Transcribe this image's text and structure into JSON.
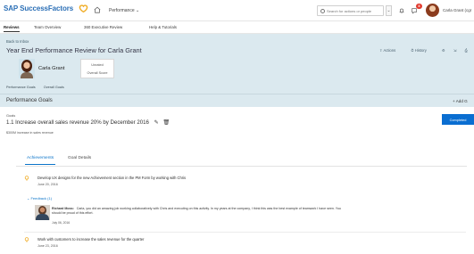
{
  "app": {
    "brand": "SAP SuccessFactors",
    "module": "Performance",
    "search_placeholder": "Search for actions or people",
    "notification_count": "8",
    "user_name": "Carla Grant (cgr"
  },
  "nav": {
    "tabs": [
      "Reviews",
      "Team Overview",
      "360 Executive Review",
      "Help & Tutorials"
    ]
  },
  "review": {
    "back_label": "Back to Inbox",
    "title": "Year End Performance Review for Carla Grant",
    "actions": [
      "Actions",
      "History"
    ],
    "person_name": "Carla Grant",
    "score_value": "Unrated",
    "score_label": "Overall Score",
    "sections": [
      "Performance Goals",
      "Overall Goals"
    ]
  },
  "performance_goals": {
    "heading": "Performance Goals",
    "add_goal_label": "+ Add G",
    "goals_label": "Goals",
    "goal_title": "1.1 Increase overall sales revenue 20% by December 2016",
    "goal_meta": "$300M increase in sales revenue",
    "complete_label": "Completed",
    "tabs": [
      "Achievements",
      "Goal Details"
    ],
    "achievements": [
      {
        "title": "Develop UX designs for the new Achievement section in the PM Form by working with Chris",
        "date": "June 20, 2016"
      },
      {
        "title": "Work with customers to increase the sales revenue for the quarter",
        "date": "June 23, 2016"
      }
    ],
    "feedback": {
      "link": "Feedback (1)",
      "name": "Richard Moss:",
      "text": "Carla, you did an amazing job working collaboratively with Chris and executing on this activity.  In my years at the company, I think this was the best example of teamwork I have seen.  You should be proud of this effort.",
      "date": "July 06, 2016"
    }
  },
  "colors": {
    "brand_blue": "#2b6fb6",
    "header_bg": "#dbe9ef",
    "primary_button": "#0a6ed1",
    "link_blue": "#0b74c9",
    "badge_red": "#e23a2e",
    "lightbulb": "#f0ad27"
  }
}
